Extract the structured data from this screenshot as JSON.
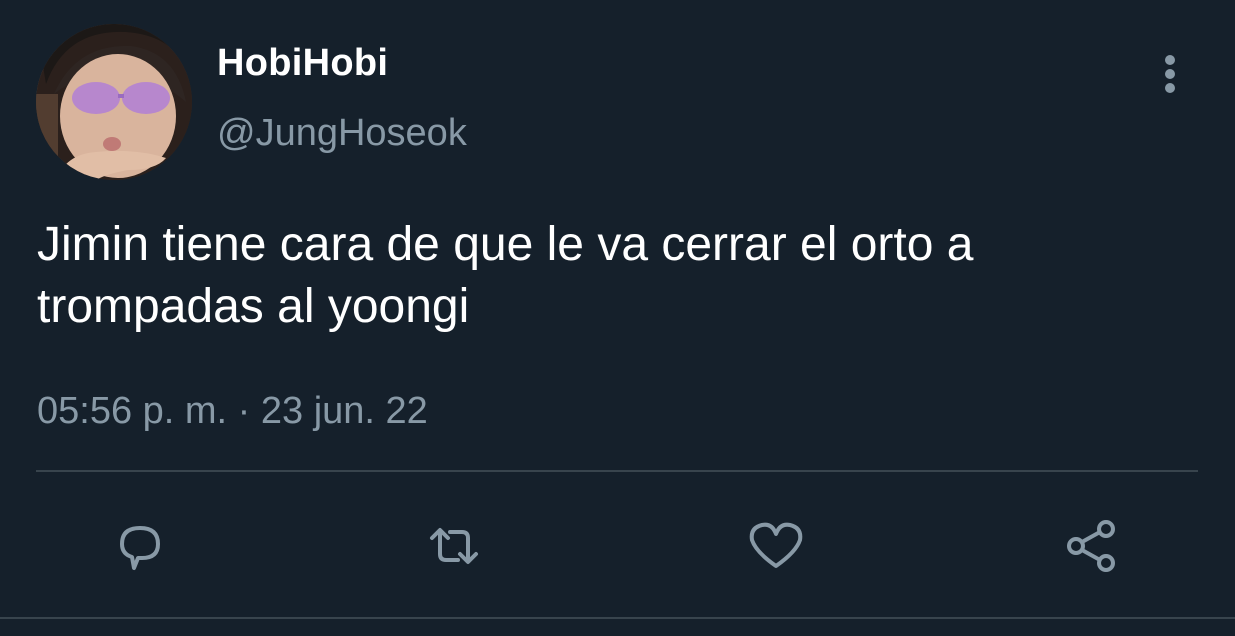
{
  "tweet": {
    "author": {
      "display_name": "HobiHobi",
      "handle": "@JungHoseok",
      "avatar_icon": "profile-photo"
    },
    "text": "Jimin tiene cara de que le va cerrar el orto a trompadas al yoongi",
    "timestamp": "05:56 p. m. · 23 jun. 22"
  },
  "actions": [
    {
      "name": "reply",
      "icon": "reply-icon"
    },
    {
      "name": "retweet",
      "icon": "retweet-icon"
    },
    {
      "name": "like",
      "icon": "heart-icon"
    },
    {
      "name": "share",
      "icon": "share-icon"
    }
  ],
  "colors": {
    "background": "#15202b",
    "primary_text": "#ffffff",
    "secondary_text": "#8899a6",
    "divider": "#38444d"
  }
}
